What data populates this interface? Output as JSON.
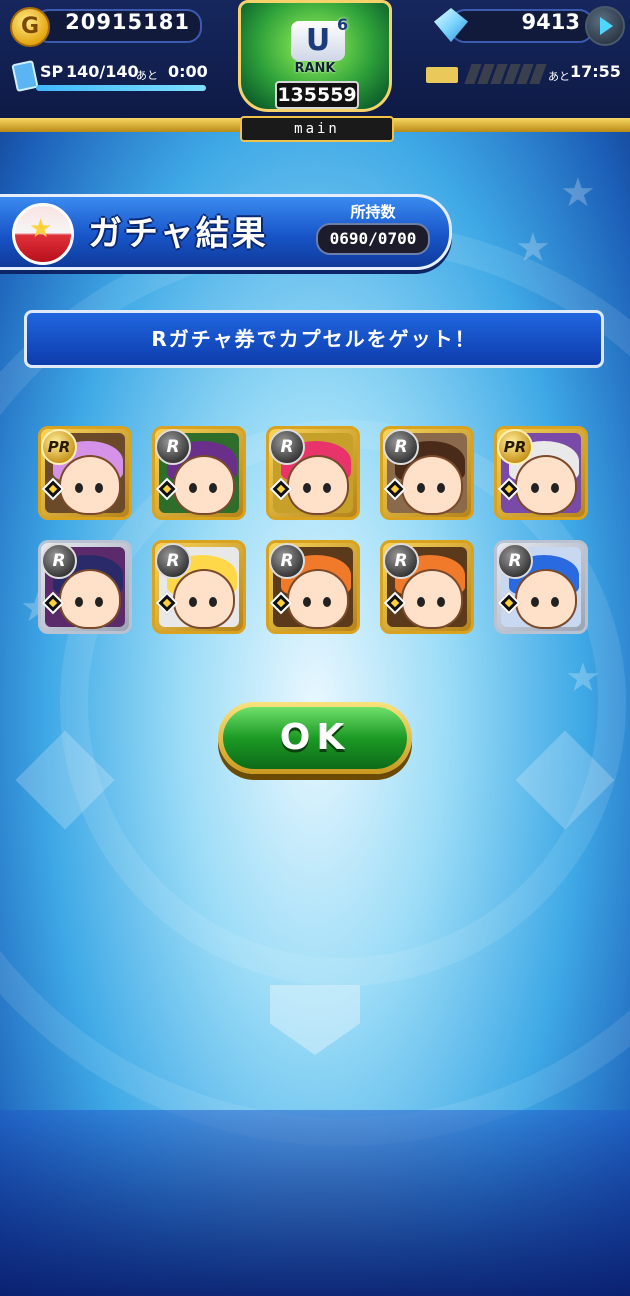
{
  "status_bar": {
    "coins": "20915181",
    "coin_icon_glyph": "G",
    "gems": "9413",
    "sp_label": "SP",
    "sp_value": "140/140",
    "sp_progress": 1.0,
    "sp_remaining_label": "あと",
    "sp_remaining_time": "0:00",
    "recharge_remaining_label": "あと",
    "recharge_remaining_time": "17:55"
  },
  "rank": {
    "tier": "U",
    "tier_level": "6",
    "label": "RANK",
    "points": "135559"
  },
  "mode_tab": "main",
  "header": {
    "title": "ガチャ結果",
    "holding_label": "所持数",
    "holding_value": "0690/0700"
  },
  "message": "Rガチャ券でカプセルをゲット！",
  "results": [
    {
      "rarity": "PR",
      "hair": "#d592e8",
      "bg": "#6b4a2a",
      "frame": "gold"
    },
    {
      "rarity": "R",
      "hair": "#6a2f8a",
      "bg": "#2e6e2a",
      "frame": "gold"
    },
    {
      "rarity": "R",
      "hair": "#e8336b",
      "bg": "#c7a02a",
      "frame": "gold"
    },
    {
      "rarity": "R",
      "hair": "#4a2a18",
      "bg": "#8a6a4a",
      "frame": "gold"
    },
    {
      "rarity": "PR",
      "hair": "#e9e9e9",
      "bg": "#7a4aa8",
      "frame": "gold"
    },
    {
      "rarity": "R",
      "hair": "#2a2a6a",
      "bg": "#5a2a6a",
      "frame": "silver"
    },
    {
      "rarity": "R",
      "hair": "#ffd84a",
      "bg": "#e8e8e8",
      "frame": "gold"
    },
    {
      "rarity": "R",
      "hair": "#f07a2a",
      "bg": "#5a3a1a",
      "frame": "gold"
    },
    {
      "rarity": "R",
      "hair": "#f07a2a",
      "bg": "#5a3a1a",
      "frame": "gold"
    },
    {
      "rarity": "R",
      "hair": "#2a6ae0",
      "bg": "#c8d8f0",
      "frame": "silver"
    }
  ],
  "ok_button": "OK",
  "colors": {
    "accent_gold": "#f0c24a",
    "banner_blue": "#1855c9",
    "ok_green": "#1c9a25"
  }
}
